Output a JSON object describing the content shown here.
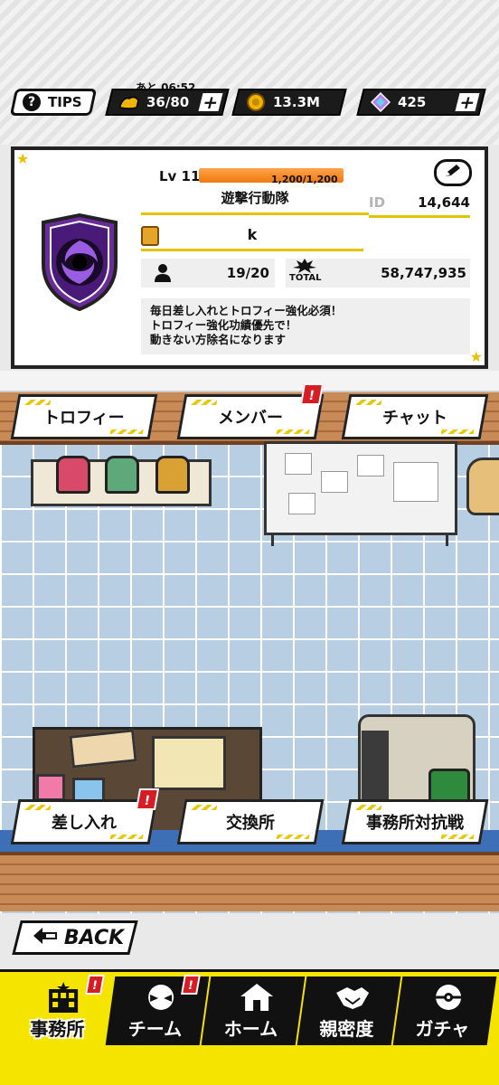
{
  "header": {
    "tips_label": "TIPS",
    "stamina": {
      "timer": "あと 06:52",
      "value": "36/80"
    },
    "coins": {
      "value": "13.3M"
    },
    "gems": {
      "value": "425"
    },
    "plus_symbol": "+"
  },
  "agency": {
    "level_label": "Lv 11",
    "exp_text": "1,200/1,200",
    "exp_progress": 1.0,
    "name": "遊撃行動隊",
    "id_label": "ID",
    "id_value": "14,644",
    "leader_name": "k",
    "members": "19/20",
    "total_label": "TOTAL",
    "total_value": "58,747,935",
    "description": [
      "毎日差し入れとトロフィー強化必須！",
      "トロフィー強化功績優先で！",
      "動きない方除名になります"
    ]
  },
  "room_buttons": {
    "trophy": "トロフィー",
    "member": "メンバー",
    "chat": "チャット",
    "gift": "差し入れ",
    "exchange": "交換所",
    "battle": "事務所対抗戦",
    "notify_mark": "!"
  },
  "back_label": "BACK",
  "nav": {
    "items": [
      {
        "label": "事務所",
        "icon": "office-building-icon",
        "active": true
      },
      {
        "label": "チーム",
        "icon": "team-mask-icon",
        "active": false
      },
      {
        "label": "ホーム",
        "icon": "home-icon",
        "active": false
      },
      {
        "label": "親密度",
        "icon": "handshake-icon",
        "active": false
      },
      {
        "label": "ガチャ",
        "icon": "gacha-capsule-icon",
        "active": false
      }
    ],
    "notify_mark": "!"
  },
  "colors": {
    "accent_yellow": "#f5e300",
    "alert_red": "#d81c24",
    "exp_orange": "#f07a10",
    "emblem_purple": "#6a2c9a"
  }
}
